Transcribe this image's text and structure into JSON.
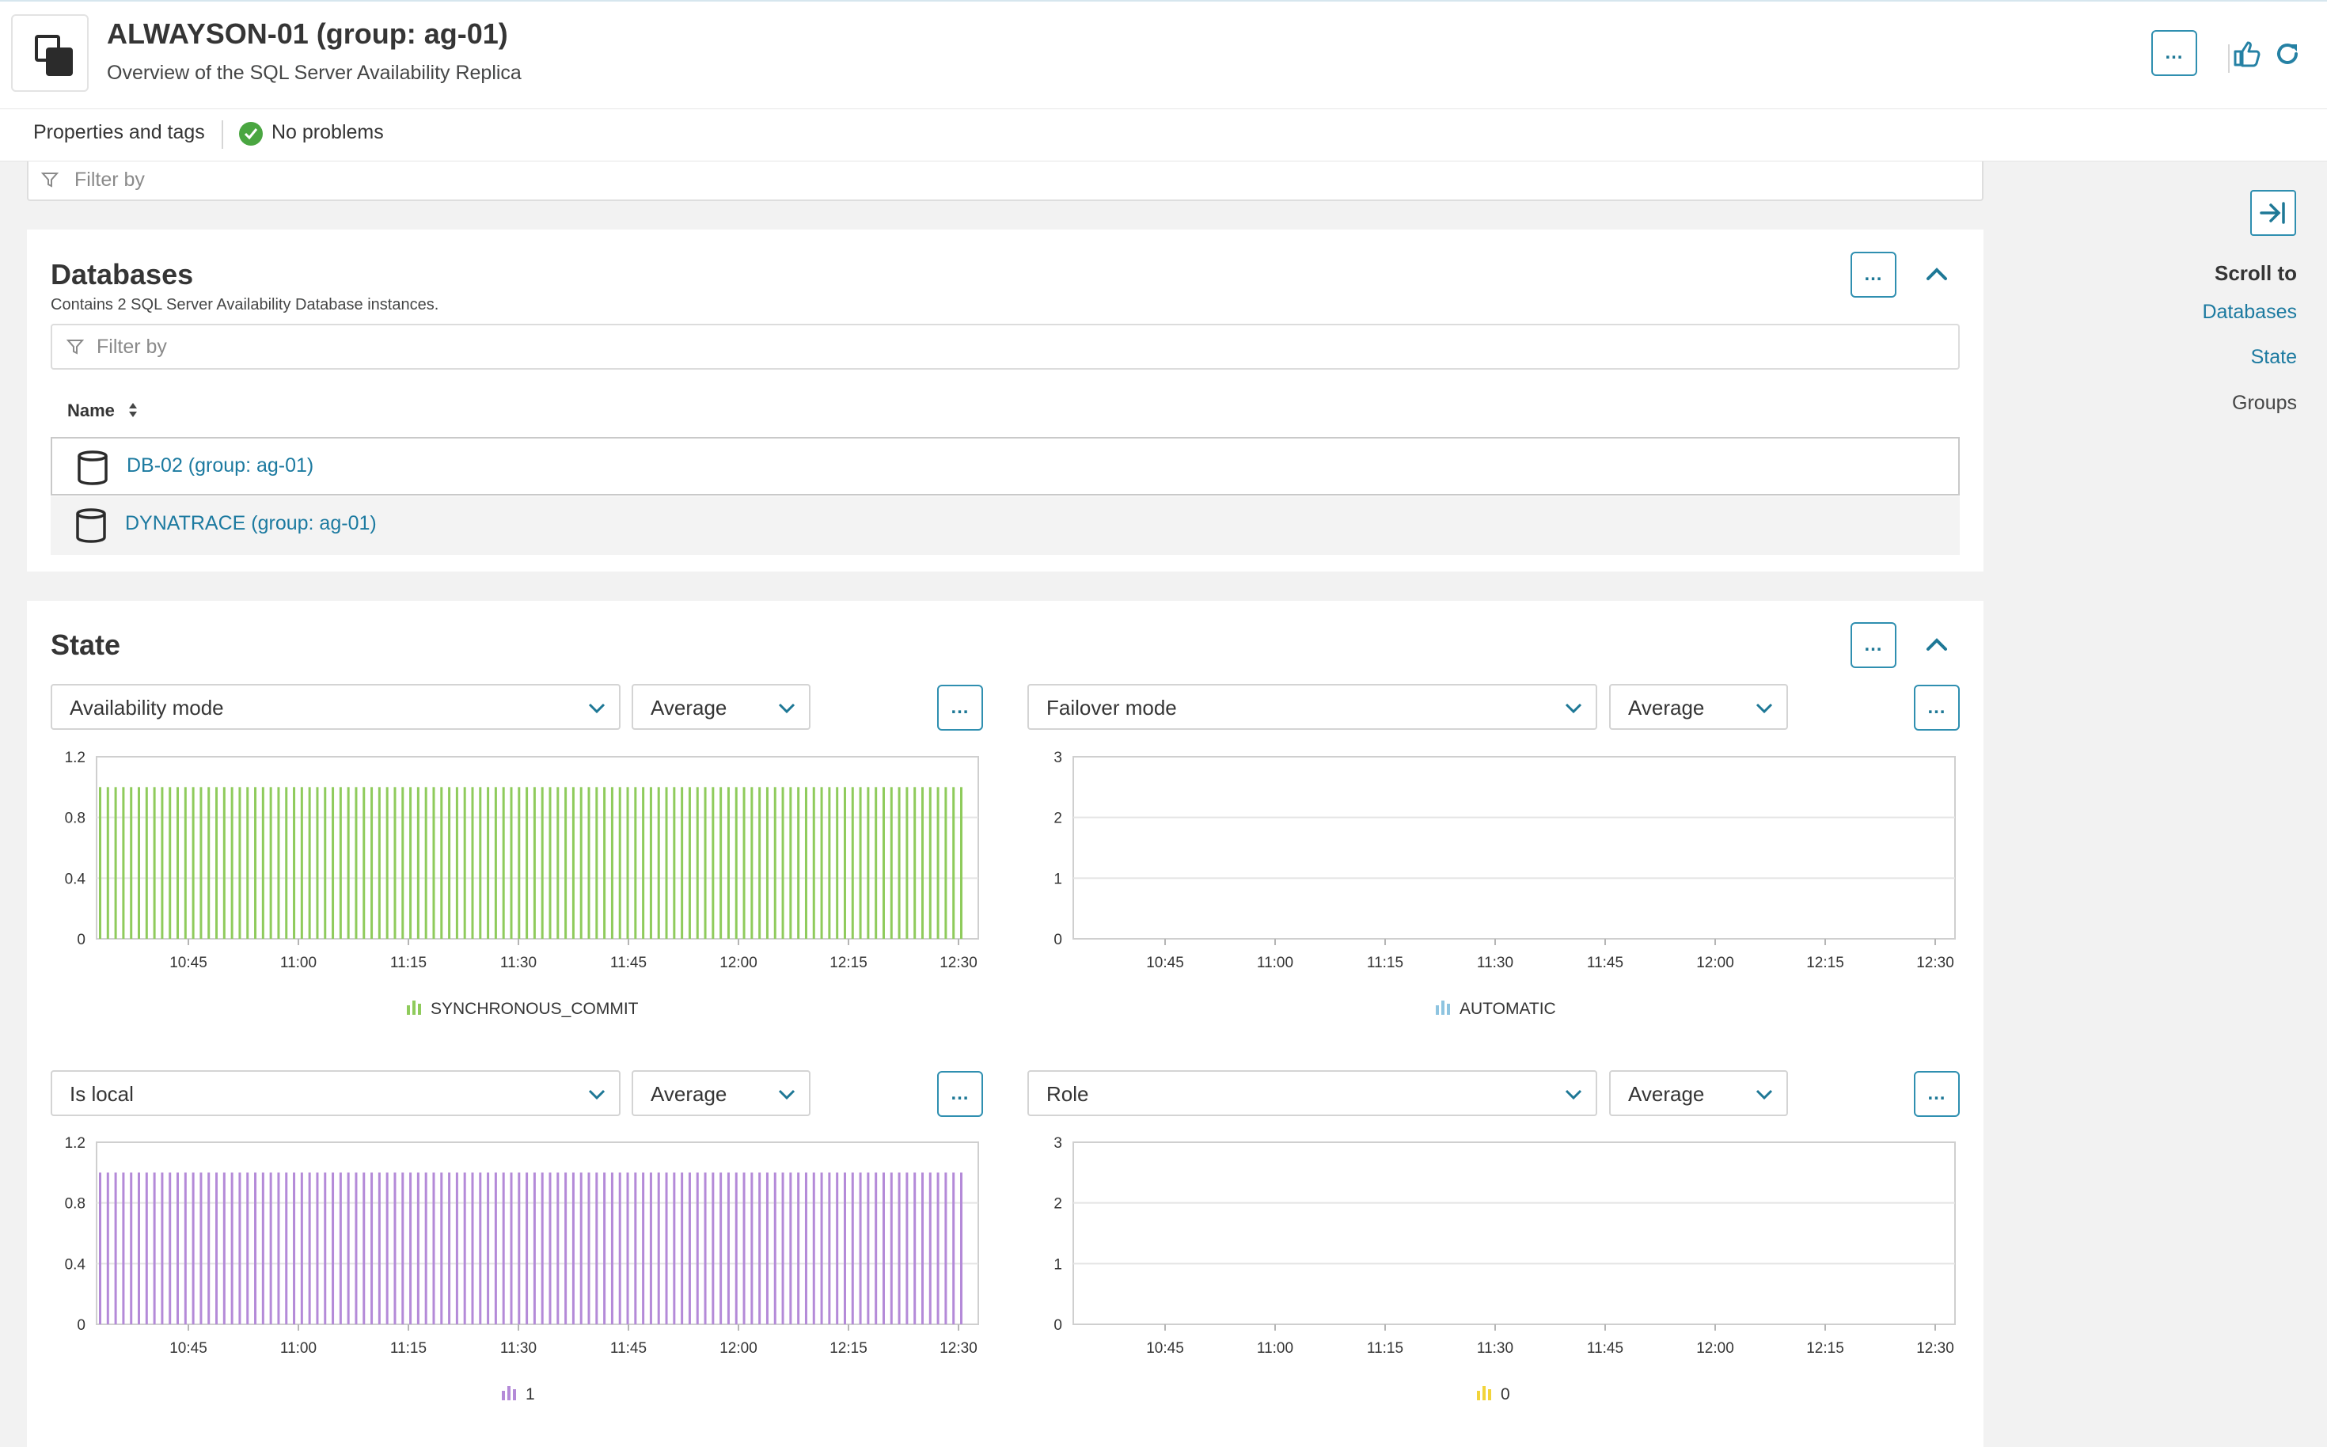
{
  "header": {
    "title": "ALWAYSON-01 (group: ag-01)",
    "subtitle": "Overview of the SQL Server Availability Replica",
    "more_label": "…",
    "entity_icon": "process-group-icon",
    "like_icon": "thumbs-up-icon",
    "refresh_icon": "refresh-icon"
  },
  "subbar": {
    "properties_label": "Properties and tags",
    "status_label": "No problems",
    "status_color": "#4aa641"
  },
  "top_filter": {
    "placeholder": "Filter by"
  },
  "databases": {
    "title": "Databases",
    "description": "Contains 2 SQL Server Availability Database instances.",
    "filter_placeholder": "Filter by",
    "column_name": "Name",
    "rows": [
      {
        "name": "DB-02 (group: ag-01)"
      },
      {
        "name": "DYNATRACE (group: ag-01)"
      }
    ]
  },
  "state": {
    "title": "State",
    "panels": [
      {
        "metric": "Availability mode",
        "aggregation": "Average",
        "legend": "SYNCHRONOUS_COMMIT",
        "color": "#8fcb5c"
      },
      {
        "metric": "Failover mode",
        "aggregation": "Average",
        "legend": "AUTOMATIC",
        "color": "#8ec4e0"
      },
      {
        "metric": "Is local",
        "aggregation": "Average",
        "legend": "1",
        "color": "#b48ad8"
      },
      {
        "metric": "Role",
        "aggregation": "Average",
        "legend": "0",
        "color": "#f2d43b"
      }
    ]
  },
  "sidebar": {
    "title": "Scroll to",
    "items": [
      {
        "label": "Databases",
        "active": true
      },
      {
        "label": "State",
        "active": true
      },
      {
        "label": "Groups",
        "active": false
      }
    ]
  },
  "chart_data": [
    {
      "type": "bar",
      "title": "",
      "x_ticks": [
        "10:45",
        "11:00",
        "11:15",
        "11:30",
        "11:45",
        "12:00",
        "12:15",
        "12:30"
      ],
      "y_ticks": [
        "0",
        "0.4",
        "0.8",
        "1.2"
      ],
      "ylim": [
        0,
        1.2
      ],
      "series": [
        {
          "name": "SYNCHRONOUS_COMMIT",
          "value": 1,
          "bar_count": 112,
          "color": "#8fcb5c"
        }
      ],
      "legend": "bottom-center",
      "grid": true
    },
    {
      "type": "bar",
      "title": "",
      "x_ticks": [
        "10:45",
        "11:00",
        "11:15",
        "11:30",
        "11:45",
        "12:00",
        "12:15",
        "12:30"
      ],
      "y_ticks": [
        "0",
        "1",
        "2",
        "3"
      ],
      "ylim": [
        0,
        3
      ],
      "series": [
        {
          "name": "AUTOMATIC",
          "value": 0,
          "bar_count": 0,
          "color": "#8ec4e0"
        }
      ],
      "legend": "bottom-center",
      "grid": true
    },
    {
      "type": "bar",
      "title": "",
      "x_ticks": [
        "10:45",
        "11:00",
        "11:15",
        "11:30",
        "11:45",
        "12:00",
        "12:15",
        "12:30"
      ],
      "y_ticks": [
        "0",
        "0.4",
        "0.8",
        "1.2"
      ],
      "ylim": [
        0,
        1.2
      ],
      "series": [
        {
          "name": "1",
          "value": 1,
          "bar_count": 112,
          "color": "#b48ad8"
        }
      ],
      "legend": "bottom-center",
      "grid": true
    },
    {
      "type": "bar",
      "title": "",
      "x_ticks": [
        "10:45",
        "11:00",
        "11:15",
        "11:30",
        "11:45",
        "12:00",
        "12:15",
        "12:30"
      ],
      "y_ticks": [
        "0",
        "1",
        "2",
        "3"
      ],
      "ylim": [
        0,
        3
      ],
      "series": [
        {
          "name": "0",
          "value": 0,
          "bar_count": 0,
          "color": "#f2d43b"
        }
      ],
      "legend": "bottom-center",
      "grid": true
    }
  ]
}
